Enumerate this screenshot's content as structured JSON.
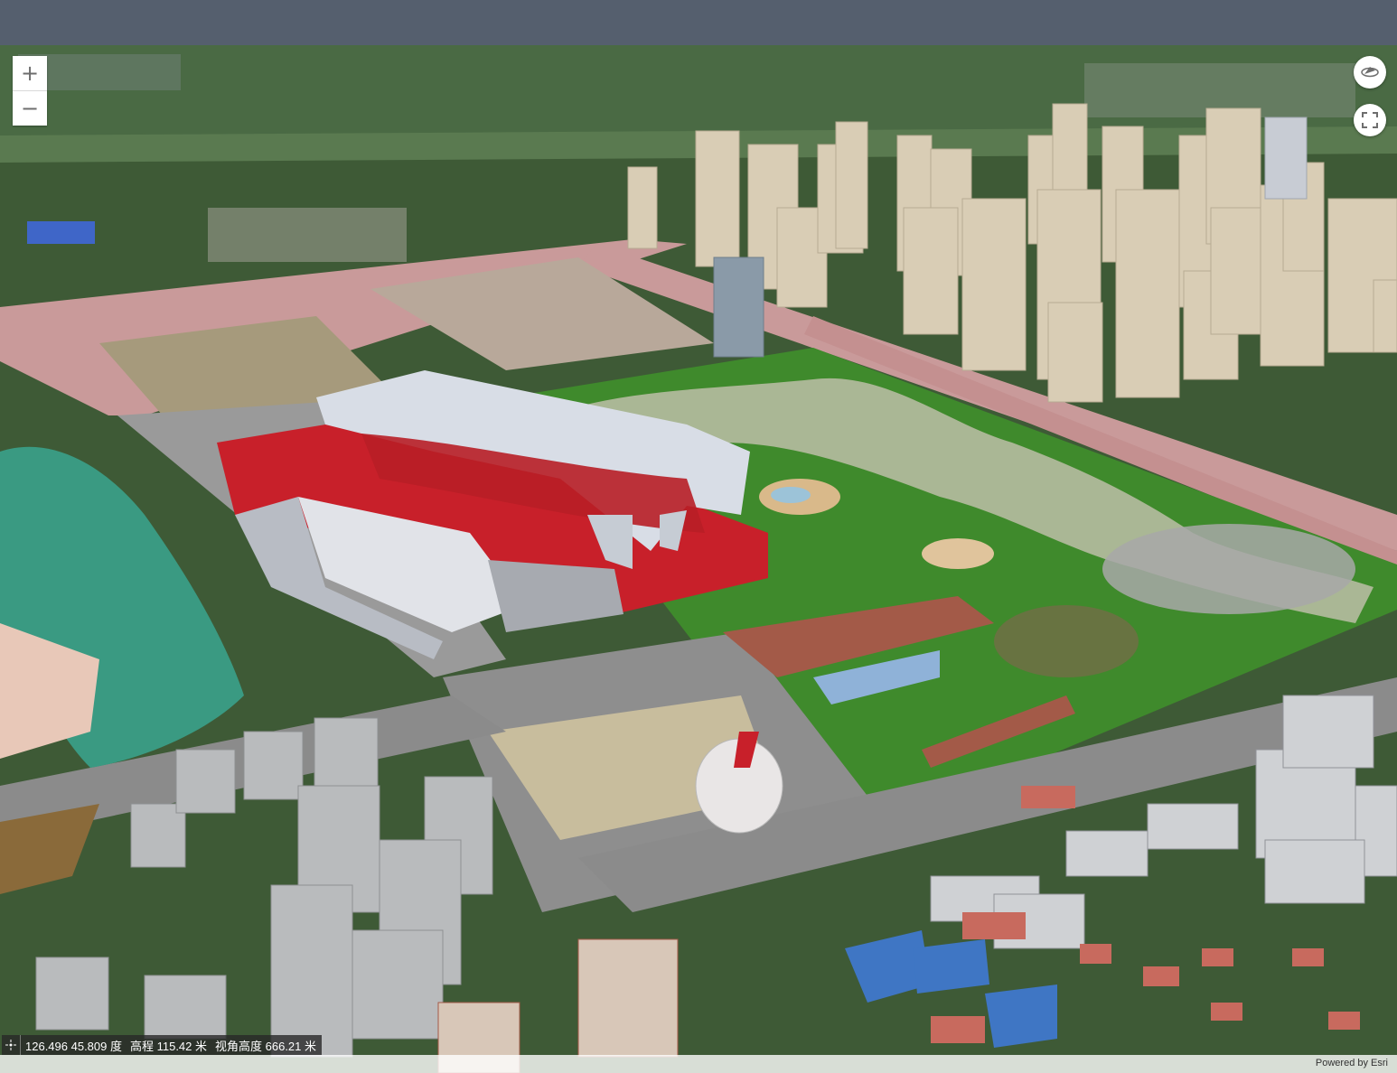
{
  "map": {
    "zoom_in_label": "+",
    "zoom_out_label": "−"
  },
  "status": {
    "coordinates": "126.496 45.809 度",
    "elevation": "高程 115.42 米",
    "camera_height": "视角高度 666.21 米"
  },
  "attribution": {
    "powered_by": "Powered by Esri"
  },
  "colors": {
    "topbar": "#555f6e",
    "vegetation": "#3e5a36",
    "park_grass": "#3f8a2c",
    "plaza": "#cfc6b8",
    "road": "#8e8e8e",
    "pink_road": "#c99a9a",
    "towers": "#d9cdb5",
    "stadium_red": "#c8202a",
    "stadium_roof": "#d8dde6",
    "water": "#3a9a82"
  },
  "icons": {
    "compass": "compass-icon",
    "fullscreen": "fullscreen-icon",
    "coords_toggle": "crosshair-icon"
  }
}
